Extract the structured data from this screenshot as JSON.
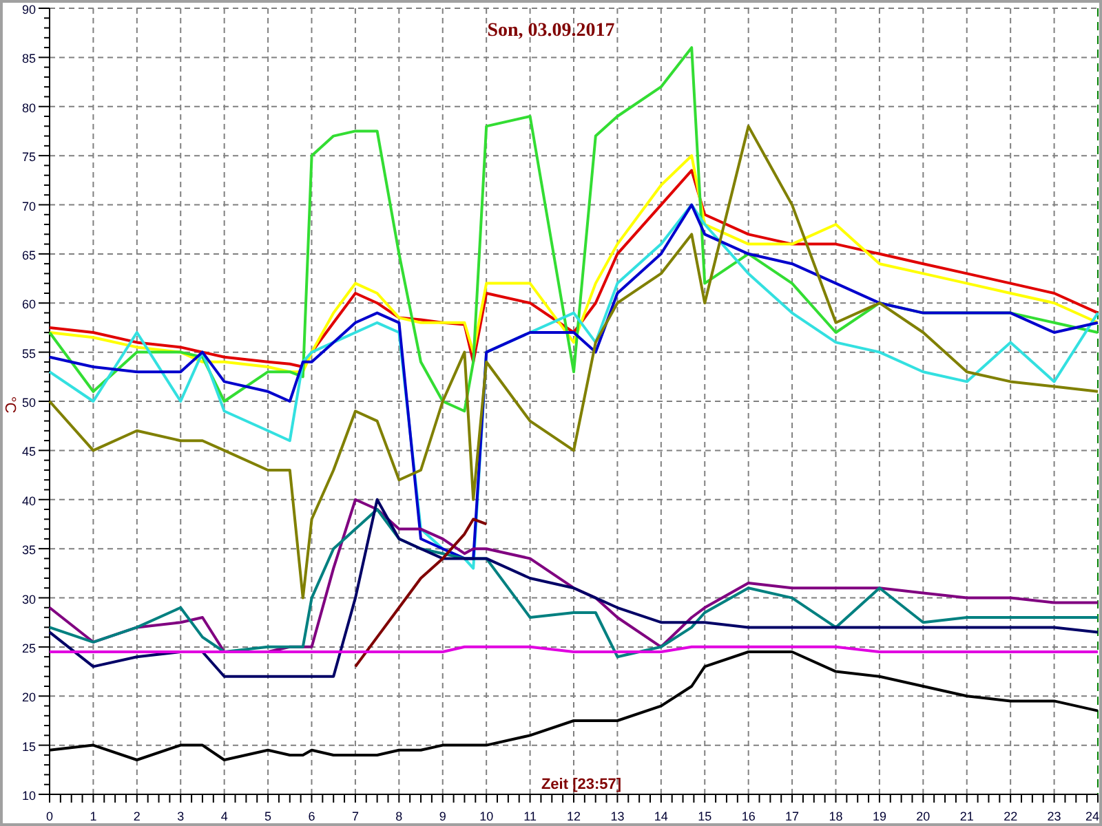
{
  "chart_data": {
    "type": "line",
    "title": "Son, 03.09.2017",
    "xlabel": "Zeit [23:57]",
    "ylabel": "°C",
    "x": [
      0,
      1,
      2,
      3,
      3.5,
      4,
      5,
      5.5,
      5.8,
      6,
      6.5,
      7,
      7.5,
      8,
      8.5,
      9,
      9.5,
      9.7,
      10,
      11,
      12,
      12.5,
      13,
      14,
      14.7,
      15,
      16,
      17,
      18,
      19,
      20,
      21,
      22,
      23,
      24
    ],
    "xlim": [
      0,
      24
    ],
    "ylim": [
      10,
      90
    ],
    "grid": true,
    "xticks": [
      0,
      1,
      2,
      3,
      4,
      5,
      6,
      7,
      8,
      9,
      10,
      11,
      12,
      13,
      14,
      15,
      16,
      17,
      18,
      19,
      20,
      21,
      22,
      23,
      24
    ],
    "yticks": [
      10,
      15,
      20,
      25,
      30,
      35,
      40,
      45,
      50,
      55,
      60,
      65,
      70,
      75,
      80,
      85,
      90
    ],
    "series": [
      {
        "color": "#e00000",
        "values": [
          57.5,
          57,
          56,
          55.5,
          55,
          54.5,
          54,
          53.8,
          53.5,
          55,
          58,
          61,
          60,
          58.5,
          58.3,
          58,
          57.8,
          54,
          61,
          60,
          57,
          60,
          65,
          70,
          73.5,
          69,
          67,
          66,
          66,
          65,
          64,
          63,
          62,
          61,
          59
        ]
      },
      {
        "color": "#ffff00",
        "values": [
          57,
          56.5,
          55.5,
          55,
          54,
          54,
          53.5,
          53,
          53,
          55,
          59,
          62,
          61,
          58.5,
          58,
          58,
          58,
          55,
          62,
          62,
          56,
          62,
          66,
          72,
          75,
          68,
          66,
          66,
          68,
          64,
          63,
          62,
          61,
          60,
          58
        ]
      },
      {
        "color": "#33dd33",
        "values": [
          57,
          51,
          55,
          55,
          54.5,
          50,
          53,
          53,
          52.5,
          75,
          77,
          77.5,
          77.5,
          65,
          54,
          50,
          49,
          54,
          78,
          79,
          53,
          77,
          79,
          82,
          86,
          62,
          65,
          62,
          57,
          60,
          59,
          59,
          59,
          58,
          57
        ]
      },
      {
        "color": "#33e0e0",
        "values": [
          53,
          50,
          57,
          50,
          55,
          49,
          47,
          46,
          54,
          55,
          56,
          57,
          58,
          57,
          37,
          35,
          34,
          33,
          55,
          57,
          59,
          56,
          62,
          66,
          70,
          68,
          63,
          59,
          56,
          55,
          53,
          52,
          56,
          52,
          59
        ]
      },
      {
        "color": "#0000cc",
        "values": [
          54.5,
          53.5,
          53,
          53,
          55,
          52,
          51,
          50,
          54,
          54,
          56,
          58,
          59,
          58,
          36,
          35,
          34,
          34,
          55,
          57,
          57,
          55,
          61,
          65,
          70,
          67,
          65,
          64,
          62,
          60,
          59,
          59,
          59,
          57,
          58
        ]
      },
      {
        "color": "#808000",
        "values": [
          50,
          45,
          47,
          46,
          46,
          45,
          43,
          43,
          30,
          38,
          43,
          49,
          48,
          42,
          43,
          50,
          55,
          40,
          54,
          48,
          45,
          56,
          60,
          63,
          67,
          60,
          78,
          70,
          58,
          60,
          57,
          53,
          52,
          51.5,
          51
        ]
      },
      {
        "color": "#800080",
        "values": [
          29,
          25.5,
          27,
          27.5,
          28,
          24.5,
          24.5,
          25,
          25,
          25,
          33,
          40,
          39,
          37,
          37,
          36,
          34.5,
          35,
          35,
          34,
          31,
          30,
          28,
          25,
          28,
          29,
          31.5,
          31,
          31,
          31,
          30.5,
          30,
          30,
          29.5,
          29.5
        ]
      },
      {
        "color": "#008080",
        "values": [
          27,
          25.5,
          27,
          29,
          26,
          24.5,
          25,
          25,
          25,
          30,
          35,
          37,
          39,
          36,
          35,
          34.5,
          34,
          34,
          34,
          28,
          28.5,
          28.5,
          24,
          25,
          27,
          28.5,
          31,
          30,
          27,
          31,
          27.5,
          28,
          28,
          28,
          28
        ]
      },
      {
        "color": "#000066",
        "values": [
          26.5,
          23,
          24,
          24.5,
          24.5,
          22,
          22,
          22,
          22,
          22,
          22,
          30,
          40,
          36,
          35,
          34,
          34,
          34,
          34,
          32,
          31,
          30,
          29,
          27.5,
          27.5,
          27.5,
          27,
          27,
          27,
          27,
          27,
          27,
          27,
          27,
          26.5
        ]
      },
      {
        "color": "#800000",
        "values": [
          null,
          null,
          null,
          null,
          null,
          null,
          null,
          null,
          null,
          null,
          null,
          23,
          26,
          29,
          32,
          34,
          36.5,
          38,
          37.5,
          null,
          null,
          null,
          null,
          null,
          null,
          null,
          null,
          null,
          null,
          null,
          null,
          null,
          null,
          null,
          null
        ]
      },
      {
        "color": "#e000e0",
        "values": [
          24.5,
          24.5,
          24.5,
          24.5,
          24.5,
          24.5,
          24.5,
          24.5,
          24.5,
          24.5,
          24.5,
          24.5,
          24.5,
          24.5,
          24.5,
          24.5,
          25,
          25,
          25,
          25,
          24.5,
          24.5,
          24.5,
          24.5,
          25,
          25,
          25,
          25,
          25,
          24.5,
          24.5,
          24.5,
          24.5,
          24.5,
          24.5
        ]
      },
      {
        "color": "#000000",
        "values": [
          14.5,
          15,
          13.5,
          15,
          15,
          13.5,
          14.5,
          14,
          14,
          14.5,
          14,
          14,
          14,
          14.5,
          14.5,
          15,
          15,
          15,
          15,
          16,
          17.5,
          17.5,
          17.5,
          19,
          21,
          23,
          24.5,
          24.5,
          22.5,
          22,
          21,
          20,
          19.5,
          19.5,
          18.5
        ]
      }
    ]
  }
}
